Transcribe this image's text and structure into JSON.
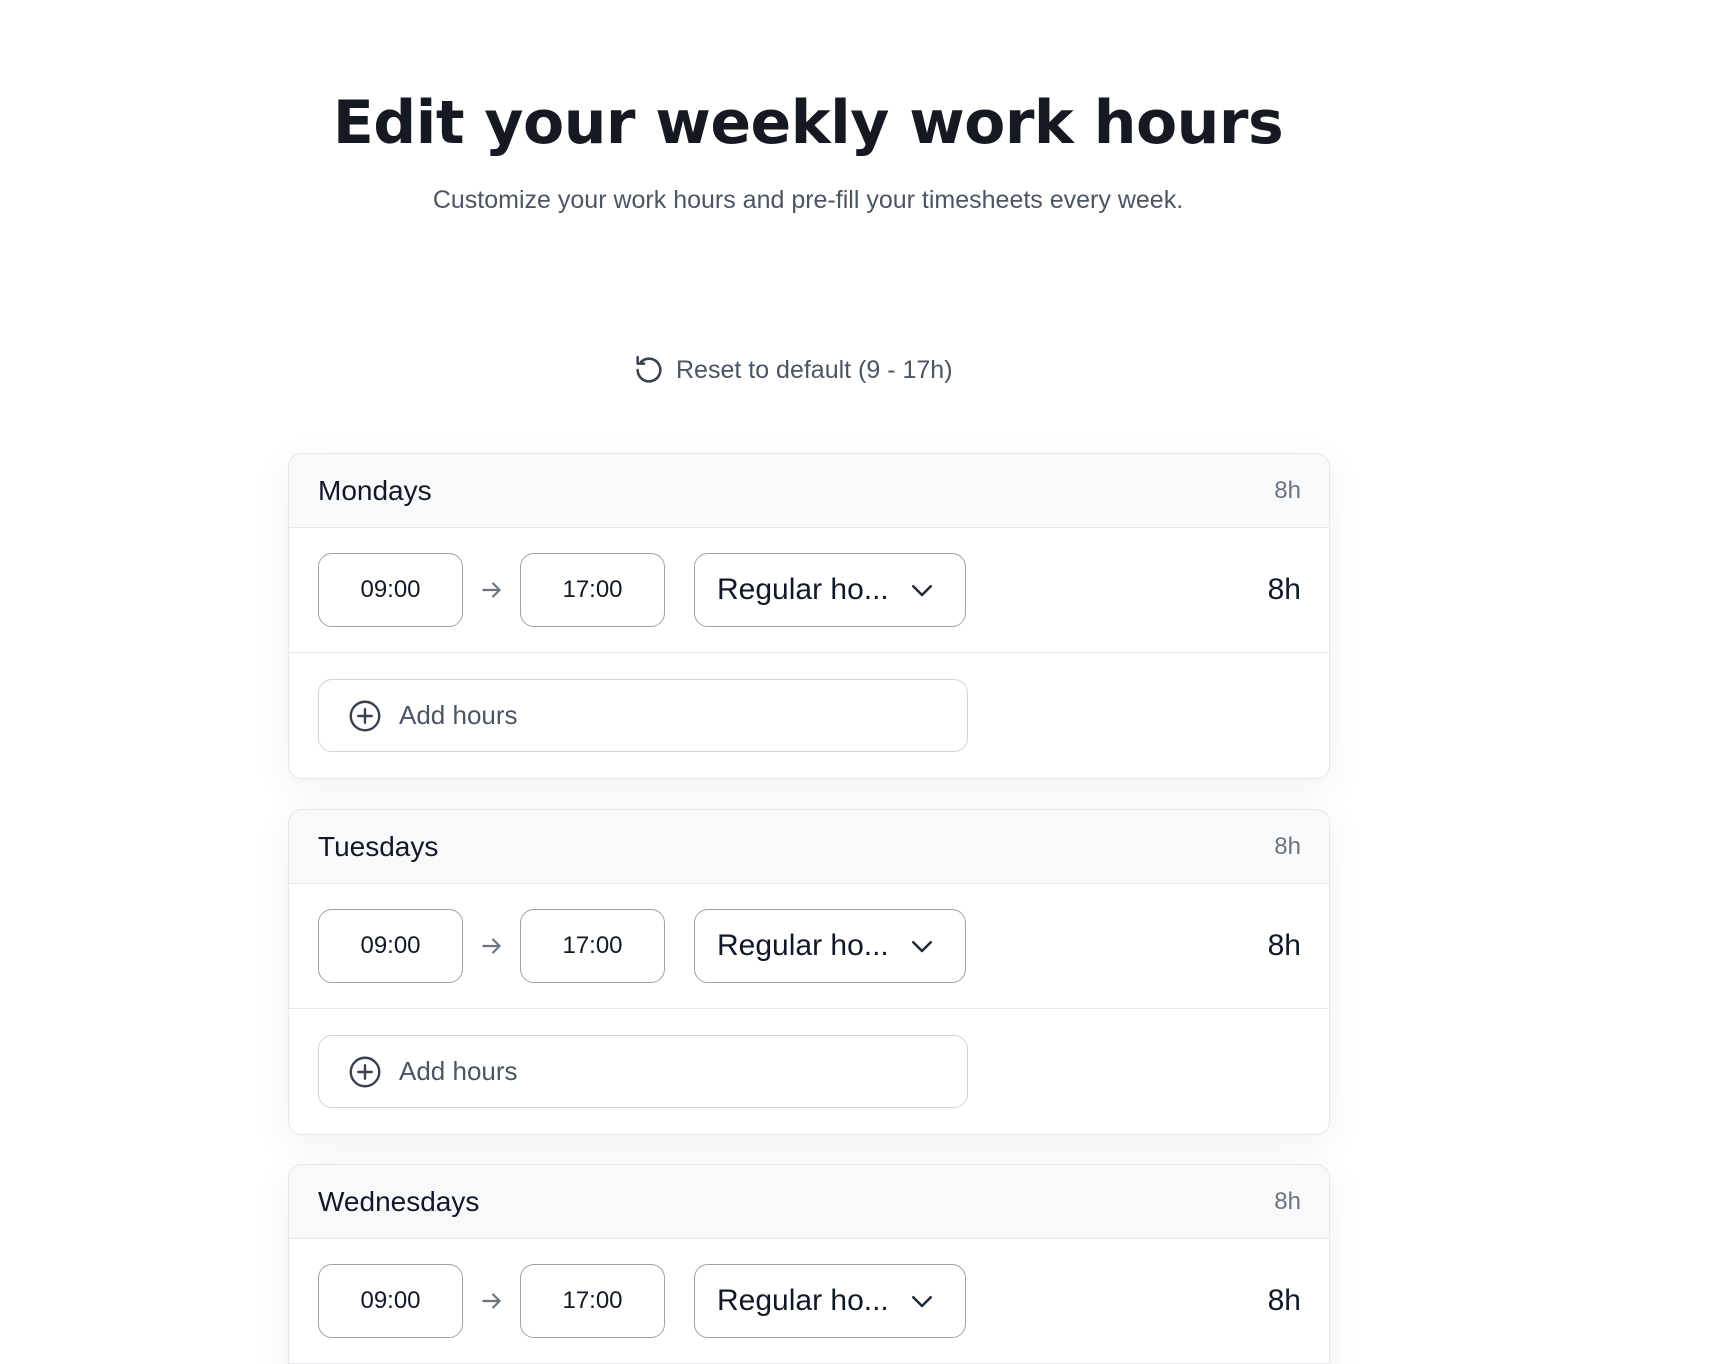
{
  "header": {
    "title": "Edit your weekly work hours",
    "subtitle": "Customize your work hours and pre-fill your timesheets every week."
  },
  "reset": {
    "label": "Reset to default (9 - 17h)",
    "icon": "reset-icon"
  },
  "days": [
    {
      "name": "Mondays",
      "total": "8h",
      "start": "09:00",
      "end": "17:00",
      "type": "Regular ho...",
      "row_total": "8h",
      "add_label": "Add hours"
    },
    {
      "name": "Tuesdays",
      "total": "8h",
      "start": "09:00",
      "end": "17:00",
      "type": "Regular ho...",
      "row_total": "8h",
      "add_label": "Add hours"
    },
    {
      "name": "Wednesdays",
      "total": "8h",
      "start": "09:00",
      "end": "17:00",
      "type": "Regular ho...",
      "row_total": "8h"
    }
  ],
  "icons": {
    "arrow": "arrow-right-icon",
    "chevron": "chevron-down-icon",
    "add": "plus-circle-icon"
  }
}
